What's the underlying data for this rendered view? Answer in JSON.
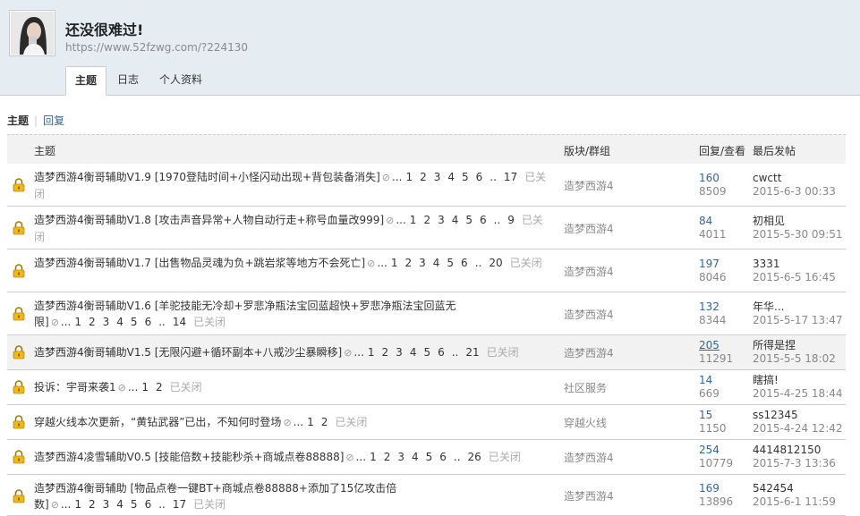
{
  "profile": {
    "name": "还没很难过!",
    "url": "https://www.52fzwg.com/?224130"
  },
  "tabs": [
    "主题",
    "日志",
    "个人资料"
  ],
  "subnav": {
    "current": "主题",
    "other": "回复"
  },
  "columns": {
    "subject": "主题",
    "forum": "版块/群组",
    "counts": "回复/查看",
    "last": "最后发帖"
  },
  "threads": [
    {
      "title": "造梦西游4衡哥辅助V1.9 [1970登陆时间+小怪闪动出现+背包装备消失]",
      "pages": [
        "1",
        "2",
        "3",
        "4",
        "5",
        "6",
        "..",
        "17"
      ],
      "status": "已关闭",
      "forum": "造梦西游4",
      "replies": "160",
      "views": "8509",
      "last_user": "cwctt",
      "last_time": "2015-6-3 00:33"
    },
    {
      "title": "造梦西游4衡哥辅助V1.8 [攻击声音异常+人物自动行走+称号血量改999]",
      "pages": [
        "1",
        "2",
        "3",
        "4",
        "5",
        "6",
        "..",
        "9"
      ],
      "status": "已关闭",
      "forum": "造梦西游4",
      "replies": "84",
      "views": "4011",
      "last_user": "初相见",
      "last_time": "2015-5-30 09:51"
    },
    {
      "title": "造梦西游4衡哥辅助V1.7 [出售物品灵魂为负+跳岩浆等地方不会死亡]",
      "pages": [
        "1",
        "2",
        "3",
        "4",
        "5",
        "6",
        "..",
        "20"
      ],
      "status": "已关闭",
      "forum": "造梦西游4",
      "replies": "197",
      "views": "8046",
      "last_user": "3331",
      "last_time": "2015-6-5 16:45"
    },
    {
      "title": "造梦西游4衡哥辅助V1.6 [羊驼技能无冷却+罗悲净瓶法宝回蓝超快+罗悲净瓶法宝回蓝无限]",
      "pages": [
        "1",
        "2",
        "3",
        "4",
        "5",
        "6",
        "..",
        "14"
      ],
      "status": "已关闭",
      "forum": "造梦西游4",
      "replies": "132",
      "views": "8344",
      "last_user": "年华...",
      "last_time": "2015-5-17 13:47"
    },
    {
      "title": "造梦西游4衡哥辅助V1.5 [无限闪避+循环副本+八戒沙尘暴瞬移]",
      "pages": [
        "1",
        "2",
        "3",
        "4",
        "5",
        "6",
        "..",
        "21"
      ],
      "status": "已关闭",
      "forum": "造梦西游4",
      "replies": "205",
      "views": "11291",
      "last_user": "所得是捏",
      "last_time": "2015-5-5 18:02"
    },
    {
      "title": "投诉：宇哥来袭1",
      "pages": [
        "1",
        "2"
      ],
      "status": "已关闭",
      "forum": "社区服务",
      "replies": "14",
      "views": "669",
      "last_user": "瞎搞!",
      "last_time": "2015-4-25 18:44"
    },
    {
      "title": "穿越火线本次更新，“黄钻武器”已出，不知何时登场",
      "pages": [
        "1",
        "2"
      ],
      "status": "已关闭",
      "forum": "穿越火线",
      "replies": "15",
      "views": "1150",
      "last_user": "ss12345",
      "last_time": "2015-4-24 12:42"
    },
    {
      "title": "造梦西游4凌雪辅助V0.5 [技能倍数+技能秒杀+商城点卷88888]",
      "pages": [
        "1",
        "2",
        "3",
        "4",
        "5",
        "6",
        "..",
        "26"
      ],
      "status": "已关闭",
      "forum": "造梦西游4",
      "replies": "254",
      "views": "10779",
      "last_user": "4414812150",
      "last_time": "2015-7-3 13:36"
    },
    {
      "title": "造梦西游4衡哥辅助 [物品点卷一键BT+商城点卷88888+添加了15亿攻击倍数]",
      "pages": [
        "1",
        "2",
        "3",
        "4",
        "5",
        "6",
        "..",
        "17"
      ],
      "status": "已关闭",
      "forum": "造梦西游4",
      "replies": "169",
      "views": "13896",
      "last_user": "542454",
      "last_time": "2015-6-1 11:59"
    }
  ]
}
